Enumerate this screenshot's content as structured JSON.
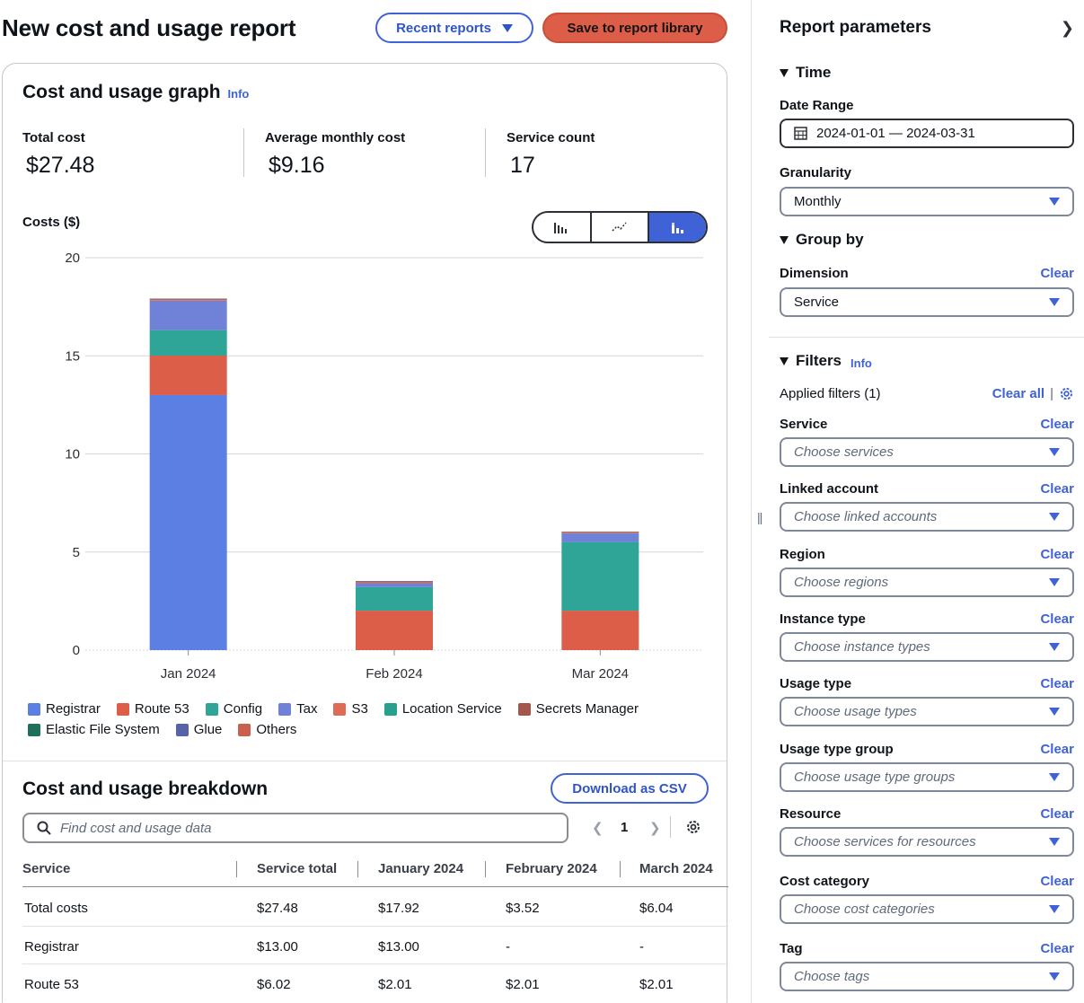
{
  "header": {
    "title": "New cost and usage report",
    "recent_reports_label": "Recent reports",
    "save_label": "Save to report library"
  },
  "graph": {
    "title": "Cost and usage graph",
    "info": "Info",
    "metrics": [
      {
        "label": "Total cost",
        "value": "$27.48"
      },
      {
        "label": "Average monthly cost",
        "value": "$9.16"
      },
      {
        "label": "Service count",
        "value": "17"
      }
    ],
    "costs_label": "Costs ($)",
    "chart_type_icons": [
      "bar-chart-icon",
      "line-chart-icon",
      "stacked-bar-chart-icon"
    ]
  },
  "chart_data": {
    "type": "bar",
    "stacked": true,
    "categories": [
      "Jan 2024",
      "Feb 2024",
      "Mar 2024"
    ],
    "ylim": [
      0,
      20
    ],
    "yticks": [
      0,
      5,
      10,
      15,
      20
    ],
    "grid": true,
    "legend_position": "bottom",
    "series": [
      {
        "name": "Registrar",
        "color": "#5b7fe3",
        "values": [
          13.0,
          0,
          0
        ]
      },
      {
        "name": "Route 53",
        "color": "#dc5e48",
        "values": [
          2.01,
          2.01,
          2.01
        ]
      },
      {
        "name": "Config",
        "color": "#2ea597",
        "values": [
          1.3,
          1.2,
          3.5
        ]
      },
      {
        "name": "Tax",
        "color": "#6f82d8",
        "values": [
          1.5,
          0.2,
          0.45
        ]
      },
      {
        "name": "S3",
        "color": "#e06b55",
        "values": [
          0.05,
          0.05,
          0.04
        ]
      },
      {
        "name": "Location Service",
        "color": "#27a08e",
        "values": [
          0,
          0,
          0.02
        ]
      },
      {
        "name": "Secrets Manager",
        "color": "#a4564c",
        "values": [
          0.03,
          0.03,
          0.01
        ]
      },
      {
        "name": "Elastic File System",
        "color": "#1f6f5c",
        "values": [
          0.01,
          0.01,
          0.0
        ]
      },
      {
        "name": "Glue",
        "color": "#5663a6",
        "values": [
          0.01,
          0.01,
          0.0
        ]
      },
      {
        "name": "Others",
        "color": "#c8614e",
        "values": [
          0.01,
          0.01,
          0.01
        ]
      }
    ]
  },
  "breakdown": {
    "title": "Cost and usage breakdown",
    "download_label": "Download as CSV",
    "search_placeholder": "Find cost and usage data",
    "page": "1",
    "columns": [
      "Service",
      "Service total",
      "January 2024",
      "February 2024",
      "March 2024"
    ],
    "rows": [
      [
        "Total costs",
        "$27.48",
        "$17.92",
        "$3.52",
        "$6.04"
      ],
      [
        "Registrar",
        "$13.00",
        "$13.00",
        "-",
        "-"
      ],
      [
        "Route 53",
        "$6.02",
        "$2.01",
        "$2.01",
        "$2.01"
      ]
    ]
  },
  "params": {
    "title": "Report parameters",
    "time_label": "Time",
    "date_range_label": "Date Range",
    "date_range_value": "2024-01-01 — 2024-03-31",
    "granularity_label": "Granularity",
    "granularity_value": "Monthly",
    "group_by_label": "Group by",
    "dimension_label": "Dimension",
    "dimension_value": "Service",
    "clear": "Clear",
    "filters_label": "Filters",
    "filters_info": "Info",
    "applied_filters": "Applied filters (1)",
    "clear_all": "Clear all",
    "filters": [
      {
        "label": "Service",
        "placeholder": "Choose services"
      },
      {
        "label": "Linked account",
        "placeholder": "Choose linked accounts"
      },
      {
        "label": "Region",
        "placeholder": "Choose regions"
      },
      {
        "label": "Instance type",
        "placeholder": "Choose instance types"
      },
      {
        "label": "Usage type",
        "placeholder": "Choose usage types"
      },
      {
        "label": "Usage type group",
        "placeholder": "Choose usage type groups"
      },
      {
        "label": "Resource",
        "placeholder": "Choose services for resources"
      },
      {
        "label": "Cost category",
        "placeholder": "Choose cost categories"
      },
      {
        "label": "Tag",
        "placeholder": "Choose tags"
      }
    ]
  }
}
